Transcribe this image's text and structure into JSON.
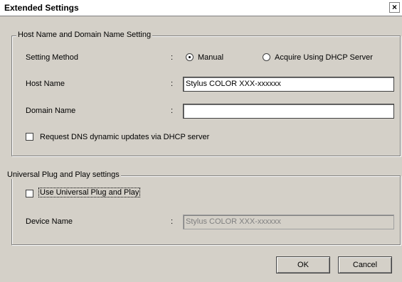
{
  "window": {
    "title": "Extended Settings",
    "close_glyph": "×"
  },
  "host_group": {
    "legend": "Host Name and Domain Name Setting",
    "setting_method_label": "Setting Method",
    "colon": ":",
    "radio_manual": "Manual",
    "radio_dhcp": "Acquire Using DHCP Server",
    "selected_method": "Manual",
    "host_name_label": "Host Name",
    "host_name_value": "Stylus COLOR XXX-xxxxxx",
    "domain_name_label": "Domain Name",
    "domain_name_value": "",
    "dns_checkbox_label": "Request DNS dynamic updates via DHCP server",
    "dns_checked": false
  },
  "upnp_group": {
    "legend": "Universal Plug and Play settings",
    "upnp_checkbox_label": "Use Universal Plug and Play",
    "upnp_checked": false,
    "device_name_label": "Device Name",
    "colon": ":",
    "device_name_value": "Stylus COLOR XXX-xxxxxx"
  },
  "buttons": {
    "ok": "OK",
    "cancel": "Cancel"
  }
}
